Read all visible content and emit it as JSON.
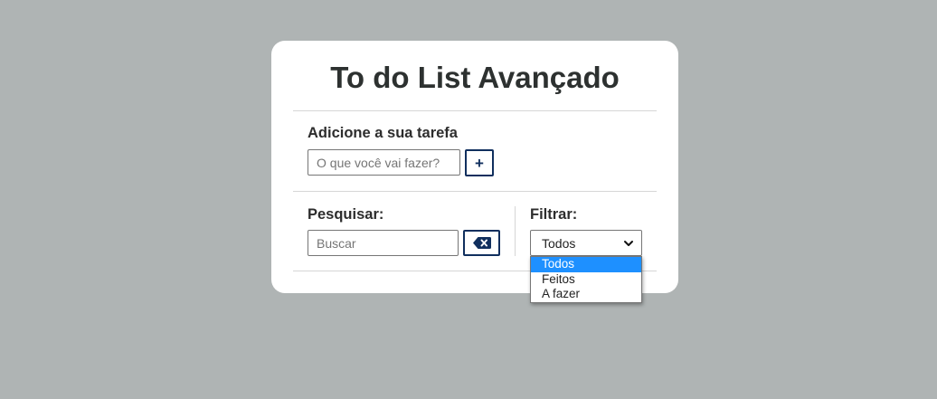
{
  "app": {
    "title": "To do List Avançado"
  },
  "add_task": {
    "label": "Adicione a sua tarefa",
    "input_value": "",
    "input_placeholder": "O que você vai fazer?",
    "add_button_label": "+"
  },
  "search": {
    "label": "Pesquisar:",
    "input_value": "",
    "input_placeholder": "Buscar",
    "clear_icon": "backspace-icon"
  },
  "filter": {
    "label": "Filtrar:",
    "selected": "Todos",
    "options": [
      "Todos",
      "Feitos",
      "A fazer"
    ],
    "highlighted_option": "Todos"
  },
  "colors": {
    "background": "#afb4b4",
    "card": "#ffffff",
    "accent": "#102f5e",
    "option_highlight": "#1e90ff"
  }
}
